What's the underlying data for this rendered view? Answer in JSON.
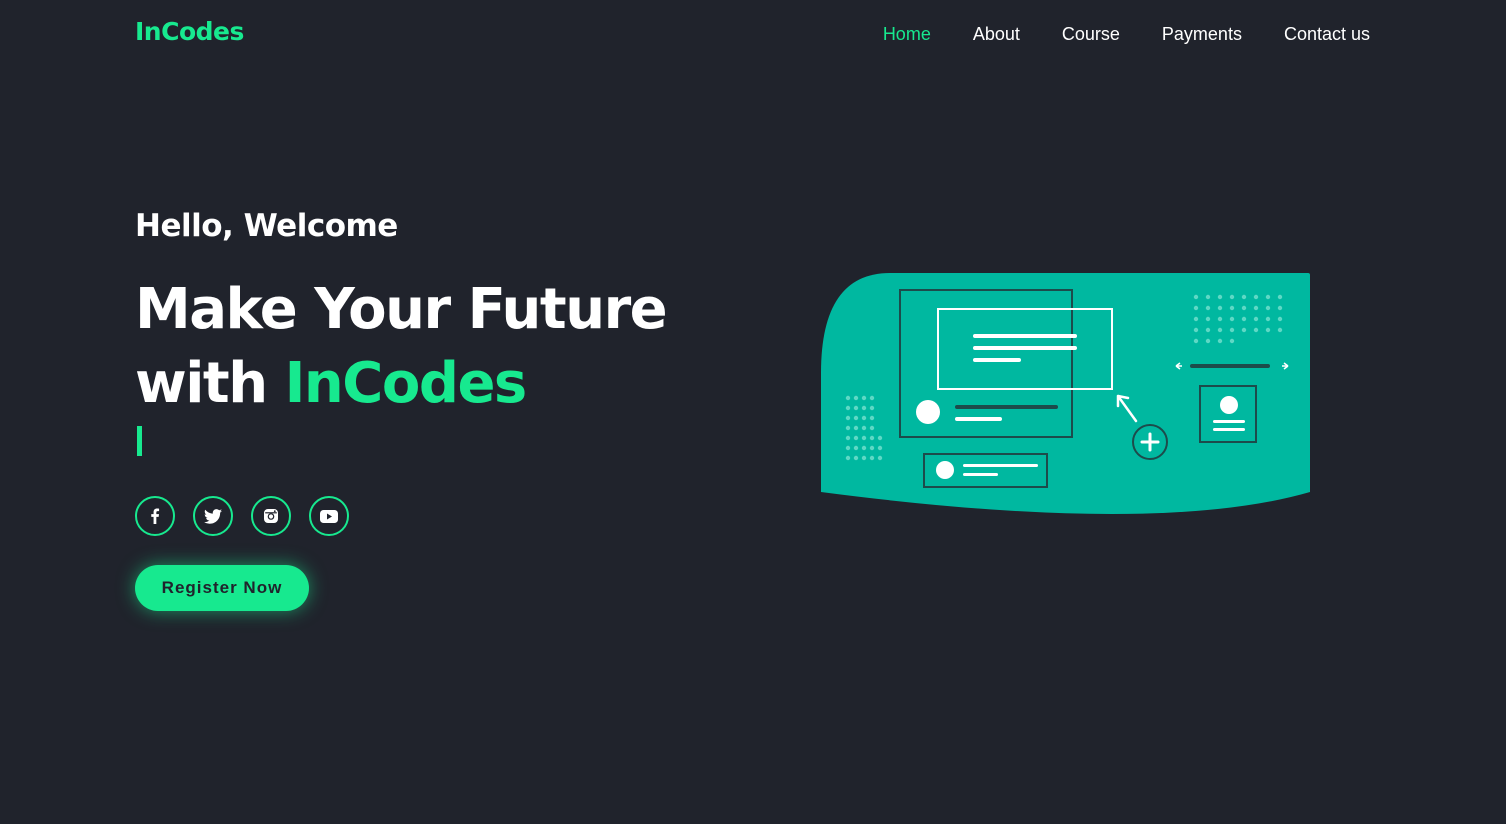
{
  "brand": {
    "name": "InCodes",
    "accent_color": "#17e98f",
    "bg_color": "#20232c"
  },
  "nav": {
    "items": [
      {
        "label": "Home",
        "active": true
      },
      {
        "label": "About",
        "active": false
      },
      {
        "label": "Course",
        "active": false
      },
      {
        "label": "Payments",
        "active": false
      },
      {
        "label": "Contact us",
        "active": false
      }
    ]
  },
  "hero": {
    "greeting": "Hello, Welcome",
    "headline_line1": "Make Your Future",
    "headline_line2_prefix": "with",
    "headline_accent": "InCodes",
    "register_label": "Register Now",
    "illustration_color": "#00b8a0"
  },
  "socials": [
    {
      "icon": "facebook-icon"
    },
    {
      "icon": "twitter-icon"
    },
    {
      "icon": "instagram-icon"
    },
    {
      "icon": "youtube-icon"
    }
  ]
}
